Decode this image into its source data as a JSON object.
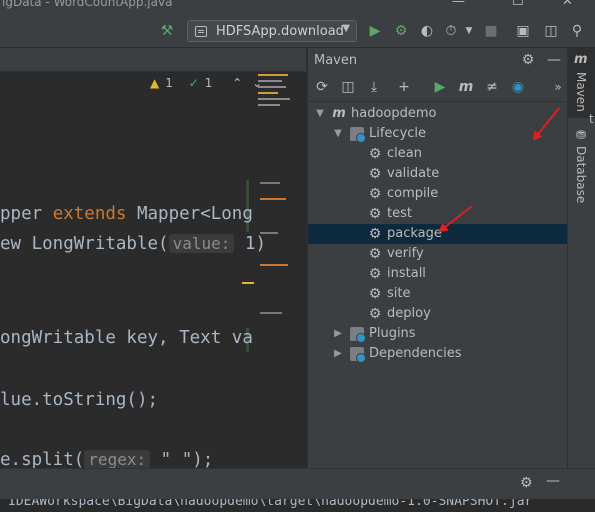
{
  "window": {
    "title": "igData - WordCountApp.java",
    "controls": [
      "—",
      "☐",
      "✕"
    ]
  },
  "toolbar": {
    "build_icon": "hammer-icon",
    "run_config_label": "HDFSApp.download",
    "run_icon": "run-icon",
    "debug_icon": "debug-icon",
    "coverage_icon": "coverage-icon",
    "profile_icon": "profile-icon",
    "stop_icon": "stop-icon",
    "project_structure_icon": "project-structure-icon",
    "layout_icon": "layout-icon",
    "search_icon": "search-icon"
  },
  "editor": {
    "inspection": {
      "warnings": "1",
      "weak_warnings": "1"
    },
    "code_lines": [
      {
        "a": "pper ",
        "b": "extends",
        "c": " Mapper<Long"
      },
      {
        "a": "ew LongWritable(",
        "hint": "value:",
        "c": " 1)"
      },
      {
        "a": "ongWritable key, Text va"
      },
      {
        "a": "lue.toString();"
      },
      {
        "a": "e.split(",
        "hint": "regex:",
        "c": " \" \");"
      }
    ]
  },
  "maven": {
    "title": "Maven",
    "project": "hadoopdemo",
    "lifecycle_label": "Lifecycle",
    "goals": [
      "clean",
      "validate",
      "compile",
      "test",
      "package",
      "verify",
      "install",
      "site",
      "deploy"
    ],
    "selected_goal": "package",
    "plugins_label": "Plugins",
    "dependencies_label": "Dependencies"
  },
  "right_sidebar": {
    "maven_tab": "Maven",
    "maven_tab_icon": "m",
    "database_tab": "Database",
    "cut_label": "t"
  },
  "bottom": {
    "path_text": "IDEAWorkspace\\BigData\\hadoopdemo\\target\\hadoopdemo-1.0-SNAPSHOT.jar"
  },
  "annotation_color": "#e02020",
  "selection_color": "#0d293e"
}
